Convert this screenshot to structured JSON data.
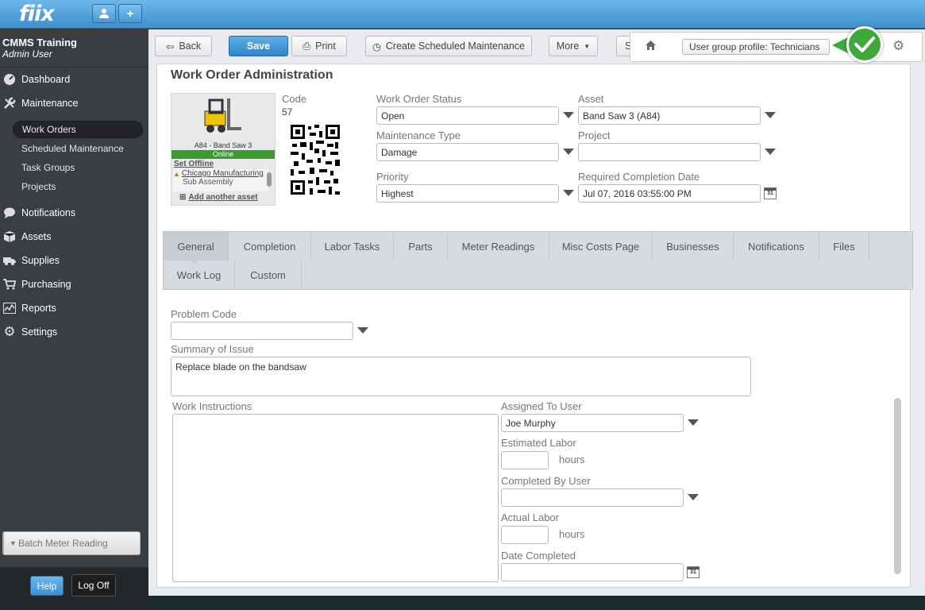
{
  "app": {
    "logo": "fiix"
  },
  "topbar": {
    "user_icon": "user-icon",
    "add_icon": "plus-icon"
  },
  "sidebar": {
    "org_name": "CMMS Training",
    "user_name": "Admin User",
    "nav": [
      {
        "label": "Dashboard",
        "icon": "dashboard-icon"
      },
      {
        "label": "Maintenance",
        "icon": "wrench-icon"
      },
      {
        "label": "Notifications",
        "icon": "chat-bubble-icon"
      },
      {
        "label": "Assets",
        "icon": "box-icon"
      },
      {
        "label": "Supplies",
        "icon": "truck-icon"
      },
      {
        "label": "Purchasing",
        "icon": "cart-icon"
      },
      {
        "label": "Reports",
        "icon": "chart-icon"
      },
      {
        "label": "Settings",
        "icon": "gear-icon"
      }
    ],
    "maintenance_sub": [
      "Work Orders",
      "Scheduled Maintenance",
      "Task Groups",
      "Projects"
    ],
    "batch_button": "Batch Meter Reading",
    "help": "Help",
    "logoff": "Log Off"
  },
  "toolbar": {
    "back": "Back",
    "save": "Save",
    "print": "Print",
    "create_sm": "Create Scheduled Maintenance",
    "more": "More",
    "cut_btn": "S",
    "user_group_profile": "User group profile: Technicians"
  },
  "page": {
    "title": "Work Order Administration"
  },
  "asset_card": {
    "name": "A84 - Band Saw 3",
    "status": "Online",
    "set_offline": "Set Offline",
    "location": "Chicago Manufacturing",
    "sub": "Sub Assembly",
    "add_asset": "Add another asset"
  },
  "header_fields": {
    "code_label": "Code",
    "code_value": "57",
    "status_label": "Work Order Status",
    "status_value": "Open",
    "asset_label": "Asset",
    "asset_value": "Band Saw 3 (A84)",
    "mtype_label": "Maintenance Type",
    "mtype_value": "Damage",
    "project_label": "Project",
    "project_value": "",
    "priority_label": "Priority",
    "priority_value": "Highest",
    "rcd_label": "Required Completion Date",
    "rcd_value": "Jul 07, 2016 03:55:00 PM",
    "cal_text": "31"
  },
  "tabs": [
    "General",
    "Completion",
    "Labor Tasks",
    "Parts",
    "Meter Readings",
    "Misc Costs Page",
    "Businesses",
    "Notifications",
    "Files",
    "Work Log",
    "Custom"
  ],
  "general": {
    "problem_code_label": "Problem Code",
    "problem_code_value": "",
    "summary_label": "Summary of Issue",
    "summary_value": "Replace blade on the bandsaw",
    "instructions_label": "Work Instructions",
    "assigned_label": "Assigned To User",
    "assigned_value": "Joe Murphy",
    "est_labor_label": "Estimated Labor",
    "hours": "hours",
    "completed_by_label": "Completed By User",
    "actual_labor_label": "Actual Labor",
    "date_completed_label": "Date Completed"
  },
  "colors": {
    "accent": "#3f8fcf",
    "sidebar": "#3a3d41",
    "online": "#3c9a2e",
    "check": "#3ea83a"
  }
}
